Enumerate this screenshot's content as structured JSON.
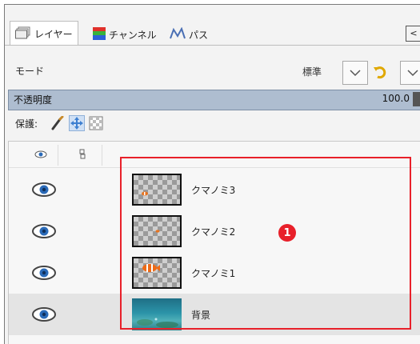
{
  "tabs": [
    {
      "label": "レイヤー",
      "icon": "layers-icon",
      "active": true
    },
    {
      "label": "チャンネル",
      "icon": "channels-icon",
      "active": false
    },
    {
      "label": "パス",
      "icon": "paths-icon",
      "active": false
    }
  ],
  "mode": {
    "label": "モード",
    "value": "標準"
  },
  "opacity": {
    "label": "不透明度",
    "value": "100.0"
  },
  "protect": {
    "label": "保護:",
    "locks": [
      "lock-pixels-icon",
      "lock-position-icon",
      "lock-alpha-icon"
    ],
    "active_lock": "lock-position-icon"
  },
  "layers": [
    {
      "name": "クマノミ3",
      "visible": true,
      "thumbnail": "transparent-fish-small"
    },
    {
      "name": "クマノミ2",
      "visible": true,
      "thumbnail": "transparent-fish-tiny"
    },
    {
      "name": "クマノミ1",
      "visible": true,
      "thumbnail": "transparent-fish"
    },
    {
      "name": "背景",
      "visible": true,
      "thumbnail": "underwater-photo",
      "selected": true
    }
  ],
  "annotation": {
    "badge": "1"
  },
  "colors": {
    "highlight": "#e8202a",
    "opacity_bar": "#aebdd0",
    "active_lock": "#cfe0f5"
  }
}
